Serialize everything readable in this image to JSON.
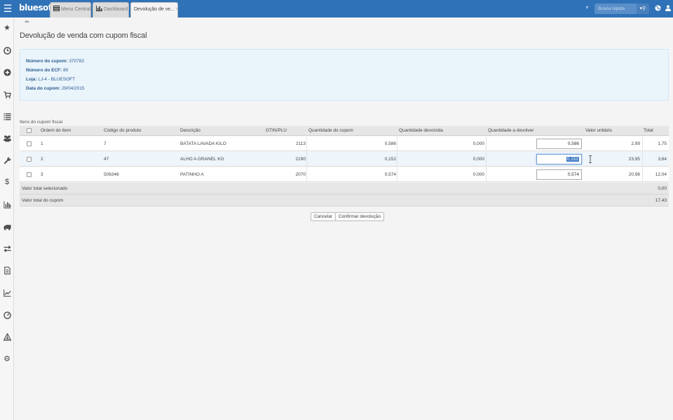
{
  "topbar": {
    "brand": "bluesoft",
    "tabs": [
      {
        "label": "Menu Central",
        "icon": "list-icon"
      },
      {
        "label": "Dashboard",
        "icon": "bar-chart-icon"
      },
      {
        "label": "Devolução de ve...",
        "active": true
      }
    ],
    "search_placeholder": "Busca rápida",
    "colors": {
      "bar": "#2f72b8",
      "search": "#5a8fc9"
    }
  },
  "sidebar": {
    "items": [
      {
        "icon": "star-icon"
      },
      {
        "icon": "clock-icon"
      },
      {
        "icon": "plus-circle-icon"
      },
      {
        "icon": "cart-icon"
      },
      {
        "icon": "list-icon"
      },
      {
        "icon": "users-icon"
      },
      {
        "icon": "wrench-icon"
      },
      {
        "icon": "dollar-icon"
      },
      {
        "icon": "bar-chart-icon"
      },
      {
        "icon": "truck-icon"
      },
      {
        "icon": "transfer-icon"
      },
      {
        "icon": "document-icon"
      },
      {
        "icon": "line-chart-icon"
      },
      {
        "icon": "dashboard-icon"
      },
      {
        "icon": "triangle-icon"
      },
      {
        "icon": "gear-icon"
      }
    ]
  },
  "page": {
    "title": "Devolução de venda com cupom fiscal",
    "info": [
      {
        "label": "Número do cupom:",
        "value": "370782"
      },
      {
        "label": "Número do ECF:",
        "value": "80"
      },
      {
        "label": "Loja:",
        "value": "LJ-4 - BLUESOFT"
      },
      {
        "label": "Data do cupom:",
        "value": "29/04/2015"
      }
    ],
    "section_label": "Itens do cupom fiscal"
  },
  "table": {
    "columns": [
      "Ordem do item",
      "Código do produto",
      "Descrição",
      "GTIN/PLU",
      "Quantidade do cupom",
      "Quantidade devolvida",
      "Quantidade a devolver",
      "Valor unitário",
      "Total"
    ],
    "rows": [
      {
        "ordem": "1",
        "codigo": "7",
        "descricao": "BATATA LAVADA KILO",
        "gtin": "2113",
        "qtd_cupom": "0,586",
        "qtd_devolvida": "0,000",
        "qtd_devolver": "0,586",
        "valor_unitario": "2,99",
        "total": "1,75"
      },
      {
        "ordem": "2",
        "codigo": "47",
        "descricao": "ALHO A GRANEL KG",
        "gtin": "2190",
        "qtd_cupom": "0,152",
        "qtd_devolvida": "0,000",
        "qtd_devolver": "0,152",
        "valor_unitario": "23,95",
        "total": "3,64"
      },
      {
        "ordem": "3",
        "codigo": "506346",
        "descricao": "PATINHO A",
        "gtin": "2070",
        "qtd_cupom": "0,574",
        "qtd_devolvida": "0,000",
        "qtd_devolver": "0,574",
        "valor_unitario": "20,98",
        "total": "12,04"
      }
    ],
    "totals": [
      {
        "label": "Valor total selecionado",
        "value": "0,00"
      },
      {
        "label": "Valor total do cupom",
        "value": "17,43"
      }
    ]
  },
  "actions": {
    "cancel": "Cancelar",
    "confirm": "Confirmar devolução"
  }
}
